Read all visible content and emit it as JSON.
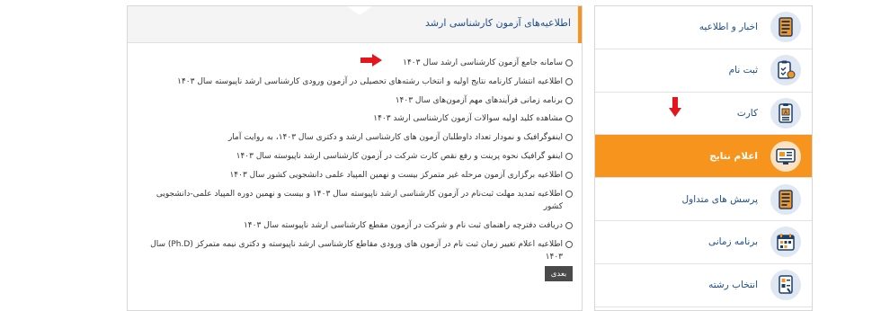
{
  "panel": {
    "title": "اطلاعیه‌های آزمون کارشناسی ارشد",
    "next_label": "بعدی",
    "items": [
      "سامانه جامع آزمون کارشناسی ارشد سال ۱۴۰۳",
      "اطلاعیه انتشار کارنامه نتایج اولیه و انتخاب رشته‌های تحصیلی در آزمون ورودی کارشناسی ارشد ناپیوسته سال ۱۴۰۳",
      "برنامه زمانی فرآیندهای مهم آزمون‌های سال ۱۴۰۳",
      "مشاهده کلید اولیه سوالات آزمون کارشناسی ارشد ۱۴۰۳",
      "اینفوگرافیک و نمودار تعداد داوطلبان آزمون های کارشناسی ارشد و دکتری سال ۱۴۰۳، به روایت آمار",
      "اینفو گرافیک نحوه پرینت و رفع نقص کارت شرکت در آزمون کارشناسی ارشد ناپیوسته سال ۱۴۰۳",
      "اطلاعیه برگزاری آزمون مرحله غیر متمرکز بیست و نهمین المپیاد علمی دانشجویی کشور سال ۱۴۰۳",
      "اطلاعیه تمدید مهلت ثبت‌نام در آزمون کارشناسی ارشد ناپیوسته سال ۱۴۰۳ و بیست و نهمین دوره المپیاد علمی-دانشجویی کشور",
      "دریافت دفترچه راهنمای ثبت نام و شرکت در آزمون مقطع کارشناسی ارشد ناپیوسته سال ۱۴۰۳",
      "اطلاعیه اعلام تغییر زمان ثبت نام در آزمون های ورودی مقاطع کارشناسی ارشد ناپیوسته و دکتری نیمه متمرکز (Ph.D) سال ۱۴۰۳"
    ]
  },
  "sidebar": {
    "items": [
      {
        "label": "اخبار و اطلاعیه",
        "icon": "news-icon"
      },
      {
        "label": "ثبت نام",
        "icon": "clipboard-register-icon"
      },
      {
        "label": "کارت",
        "icon": "id-card-icon"
      },
      {
        "label": "اعلام نتایج",
        "icon": "results-board-icon"
      },
      {
        "label": "پرسش های متداول",
        "icon": "faq-document-icon"
      },
      {
        "label": "برنامه زمانی",
        "icon": "calendar-icon"
      },
      {
        "label": "انتخاب رشته",
        "icon": "choose-field-icon"
      }
    ]
  },
  "colors": {
    "accent_orange": "#f7941d",
    "link_blue": "#1f4e8a",
    "arrow_red": "#e4151c"
  }
}
